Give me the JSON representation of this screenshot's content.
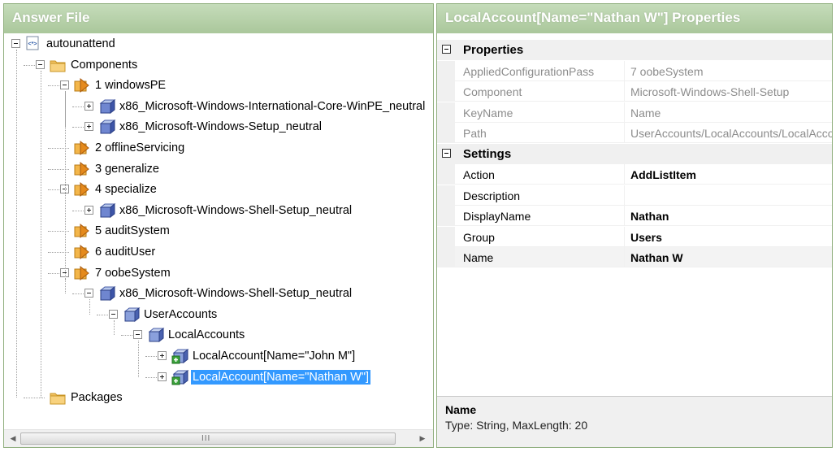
{
  "answer_file": {
    "title": "Answer File",
    "tree": [
      {
        "label": "autounattend",
        "icon": "xml-file-icon",
        "expander": "minus"
      },
      {
        "label": "Components",
        "icon": "folder-icon",
        "expander": "minus"
      },
      {
        "label": "1 windowsPE",
        "icon": "config-pass-icon",
        "expander": "minus"
      },
      {
        "label": "x86_Microsoft-Windows-International-Core-WinPE_neutral",
        "icon": "component-icon",
        "expander": "plus"
      },
      {
        "label": "x86_Microsoft-Windows-Setup_neutral",
        "icon": "component-icon",
        "expander": "plus"
      },
      {
        "label": "2 offlineServicing",
        "icon": "config-pass-icon",
        "expander": "none"
      },
      {
        "label": "3 generalize",
        "icon": "config-pass-icon",
        "expander": "none"
      },
      {
        "label": "4 specialize",
        "icon": "config-pass-icon",
        "expander": "minus"
      },
      {
        "label": "x86_Microsoft-Windows-Shell-Setup_neutral",
        "icon": "component-icon",
        "expander": "plus"
      },
      {
        "label": "5 auditSystem",
        "icon": "config-pass-icon",
        "expander": "none"
      },
      {
        "label": "6 auditUser",
        "icon": "config-pass-icon",
        "expander": "none"
      },
      {
        "label": "7 oobeSystem",
        "icon": "config-pass-icon",
        "expander": "minus"
      },
      {
        "label": "x86_Microsoft-Windows-Shell-Setup_neutral",
        "icon": "component-icon",
        "expander": "minus"
      },
      {
        "label": "UserAccounts",
        "icon": "setting-group-icon",
        "expander": "minus"
      },
      {
        "label": "LocalAccounts",
        "icon": "setting-group-icon",
        "expander": "minus"
      },
      {
        "label": "LocalAccount[Name=\"John M\"]",
        "icon": "list-item-icon",
        "expander": "plus"
      },
      {
        "label": "LocalAccount[Name=\"Nathan W\"]",
        "icon": "list-item-icon",
        "expander": "plus",
        "selected": true
      },
      {
        "label": "Packages",
        "icon": "folder-icon",
        "expander": "none"
      }
    ],
    "scrollbar": {
      "left_arrow": "◀",
      "right_arrow": "▶",
      "grip": "III"
    }
  },
  "properties": {
    "title": "LocalAccount[Name=\"Nathan W\"] Properties",
    "categories": [
      {
        "label": "Properties",
        "rows": [
          {
            "name": "AppliedConfigurationPass",
            "value": "7 oobeSystem",
            "readonly": true
          },
          {
            "name": "Component",
            "value": "Microsoft-Windows-Shell-Setup",
            "readonly": true
          },
          {
            "name": "KeyName",
            "value": "Name",
            "readonly": true
          },
          {
            "name": "Path",
            "value": "UserAccounts/LocalAccounts/LocalAccount",
            "readonly": true
          }
        ]
      },
      {
        "label": "Settings",
        "rows": [
          {
            "name": "Action",
            "value": "AddListItem",
            "bold": true
          },
          {
            "name": "Description",
            "value": ""
          },
          {
            "name": "DisplayName",
            "value": "Nathan",
            "bold": true
          },
          {
            "name": "Group",
            "value": "Users",
            "bold": true
          },
          {
            "name": "Name",
            "value": "Nathan W",
            "bold": true,
            "highlight": true
          }
        ]
      }
    ],
    "description": {
      "title": "Name",
      "text": "Type: String, MaxLength: 20"
    }
  },
  "colors": {
    "header_green": "#aac79b",
    "selection": "#3399ff",
    "border": "#8fae7d"
  }
}
